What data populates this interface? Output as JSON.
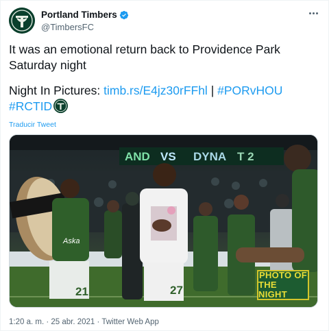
{
  "author": {
    "display_name": "Portland Timbers",
    "handle": "@TimbersFC",
    "verified": true
  },
  "tweet": {
    "line1": "It was an emotional return back to Providence Park",
    "line2": "Saturday night",
    "line3_prefix": "Night In Pictures: ",
    "link_url": "timb.rs/E4jz30rFFhl",
    "separator": " | ",
    "hashtag1": "#PORvHOU",
    "hashtag2": "#RCTID"
  },
  "translate_label": "Traducir Tweet",
  "photo": {
    "scoreboard_left": "AND",
    "scoreboard_vs": "VS",
    "scoreboard_team": "DYNA",
    "scoreboard_score": "T 2",
    "badge_line1": "PHOTO OF",
    "badge_line2": "THE NIGHT",
    "jersey_left_number": "21",
    "jersey_center_number": "27",
    "jersey_left_text": "Aska"
  },
  "meta": {
    "time": "1:20 a. m.",
    "dot1": " · ",
    "date": "25 abr. 2021",
    "dot2": " · ",
    "source": "Twitter Web App"
  },
  "colors": {
    "link": "#1d9bf0",
    "timbers_green": "#0a3f2c",
    "badge_yellow": "#e8dd36"
  },
  "icons": {
    "avatar": "timbers-axe-logo",
    "verified": "verified-badge-icon",
    "more": "more-options-icon",
    "emoji": "timbers-logo-emoji"
  }
}
